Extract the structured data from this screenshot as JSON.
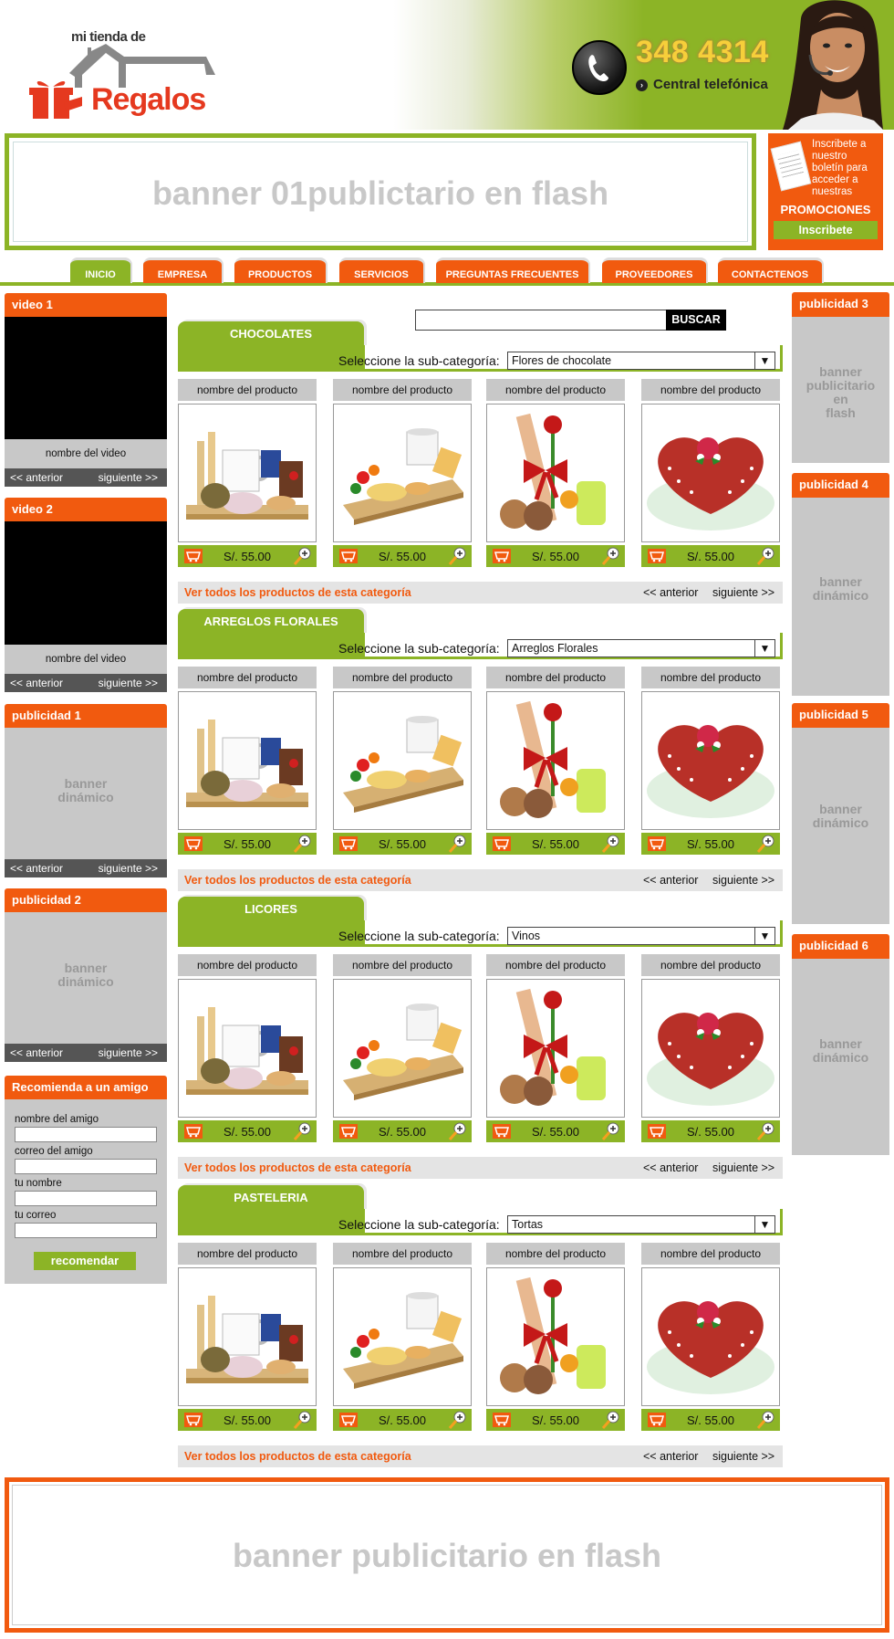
{
  "header": {
    "logo_top": "mi tienda de",
    "logo_main": "Regalos",
    "phone_number": "348 4314",
    "phone_label": "Central telefónica"
  },
  "top_banner": {
    "text": "banner 01publictario en flash"
  },
  "subscribe": {
    "text": "Inscribete a nuestro boletín para acceder a nuestras",
    "promo": "PROMOCIONES",
    "button": "Inscribete"
  },
  "nav": {
    "tabs": [
      {
        "label": "INICIO",
        "active": true
      },
      {
        "label": "EMPRESA"
      },
      {
        "label": "PRODUCTOS"
      },
      {
        "label": "SERVICIOS"
      },
      {
        "label": "PREGUNTAS FRECUENTES"
      },
      {
        "label": "PROVEEDORES"
      },
      {
        "label": "CONTACTENOS"
      }
    ]
  },
  "left": {
    "video1": {
      "title": "video 1",
      "name": "nombre del video",
      "prev": "<< anterior",
      "next": "siguiente >>"
    },
    "video2": {
      "title": "video 2",
      "name": "nombre del video",
      "prev": "<< anterior",
      "next": "siguiente >>"
    },
    "pub1": {
      "title": "publicidad 1",
      "text1": "banner",
      "text2": "dinámico",
      "prev": "<< anterior",
      "next": "siguiente >>"
    },
    "pub2": {
      "title": "publicidad 2",
      "text1": "banner",
      "text2": "dinámico",
      "prev": "<< anterior",
      "next": "siguiente >>"
    },
    "recommend": {
      "title": "Recomienda a un amigo",
      "friend_name": "nombre del amigo",
      "friend_email": "correo del amigo",
      "your_name": "tu nombre",
      "your_email": "tu correo",
      "button": "recomendar"
    }
  },
  "right": {
    "pub3": {
      "title": "publicidad 3",
      "lines": [
        "banner",
        "publicitario",
        "en",
        "flash"
      ]
    },
    "pub4": {
      "title": "publicidad 4",
      "text1": "banner",
      "text2": "dinámico"
    },
    "pub5": {
      "title": "publicidad 5",
      "text1": "banner",
      "text2": "dinámico"
    },
    "pub6": {
      "title": "publicidad 6",
      "text1": "banner",
      "text2": "dinámico"
    }
  },
  "search": {
    "button": "BUSCAR",
    "value": ""
  },
  "categories": [
    {
      "name": "CHOCOLATES",
      "subcat_label": "Seleccione la sub-categoría:",
      "subcat": "Flores de chocolate",
      "see_all": "Ver todos los productos de esta categoría",
      "prev": "<< anterior",
      "next": "siguiente >>",
      "products": [
        {
          "name": "nombre del producto",
          "price": "S/. 55.00"
        },
        {
          "name": "nombre del producto",
          "price": "S/. 55.00"
        },
        {
          "name": "nombre del producto",
          "price": "S/. 55.00"
        },
        {
          "name": "nombre del producto",
          "price": "S/. 55.00"
        }
      ]
    },
    {
      "name": "ARREGLOS FLORALES",
      "subcat_label": "Seleccione la sub-categoría:",
      "subcat": "Arreglos Florales",
      "see_all": "Ver todos los productos de esta categoría",
      "prev": "<< anterior",
      "next": "siguiente >>",
      "products": [
        {
          "name": "nombre del producto",
          "price": "S/. 55.00"
        },
        {
          "name": "nombre del producto",
          "price": "S/. 55.00"
        },
        {
          "name": "nombre del producto",
          "price": "S/. 55.00"
        },
        {
          "name": "nombre del producto",
          "price": "S/. 55.00"
        }
      ]
    },
    {
      "name": "LICORES",
      "subcat_label": "Seleccione la sub-categoría:",
      "subcat": "Vinos",
      "see_all": "Ver todos los productos de esta categoría",
      "prev": "<< anterior",
      "next": "siguiente >>",
      "products": [
        {
          "name": "nombre del producto",
          "price": "S/. 55.00"
        },
        {
          "name": "nombre del producto",
          "price": "S/. 55.00"
        },
        {
          "name": "nombre del producto",
          "price": "S/. 55.00"
        },
        {
          "name": "nombre del producto",
          "price": "S/. 55.00"
        }
      ]
    },
    {
      "name": "PASTELERIA",
      "subcat_label": "Seleccione la sub-categoría:",
      "subcat": "Tortas",
      "see_all": "Ver todos los productos de esta categoría",
      "prev": "<< anterior",
      "next": "siguiente >>",
      "products": [
        {
          "name": "nombre del producto",
          "price": "S/. 55.00"
        },
        {
          "name": "nombre del producto",
          "price": "S/. 55.00"
        },
        {
          "name": "nombre del producto",
          "price": "S/. 55.00"
        },
        {
          "name": "nombre del producto",
          "price": "S/. 55.00"
        }
      ]
    }
  ],
  "bottom_banner": {
    "text": "banner publicitario en flash"
  },
  "colors": {
    "green": "#8cb426",
    "orange": "#f15a0f",
    "gray": "#c8c8c8"
  }
}
